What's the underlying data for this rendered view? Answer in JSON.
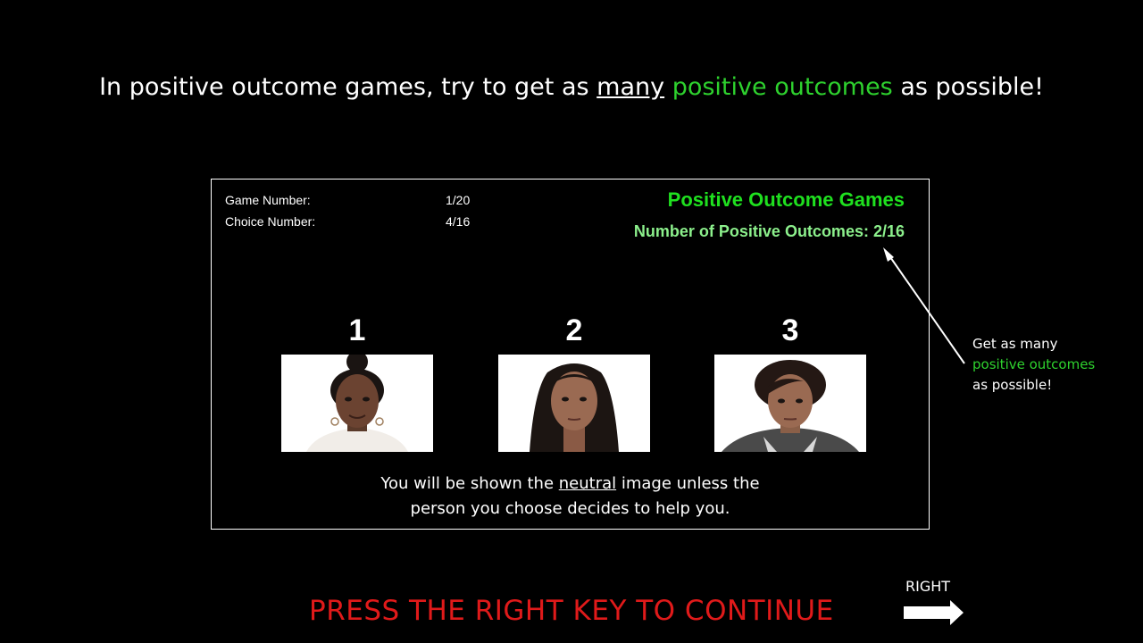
{
  "heading": {
    "part1": "In positive outcome games, try to get as ",
    "underlined": "many",
    "green": "positive outcomes",
    "part2": " as possible!"
  },
  "panel": {
    "game_number_label": "Game Number:",
    "game_number_value": "1/20",
    "choice_number_label": "Choice Number:",
    "choice_number_value": "4/16",
    "title": "Positive Outcome Games",
    "outcome_count": "Number of Positive Outcomes: 2/16",
    "choices": [
      {
        "number": "1",
        "face": "person-1"
      },
      {
        "number": "2",
        "face": "person-2"
      },
      {
        "number": "3",
        "face": "person-3"
      }
    ],
    "instruction": {
      "part1": "You will be shown the ",
      "underlined": "neutral",
      "part2": " image unless the",
      "line2": "person you choose decides to help you."
    }
  },
  "callout": {
    "line1": "Get as many",
    "line2": "positive outcomes",
    "line3": "as possible!"
  },
  "footer": {
    "press_text": "PRESS THE RIGHT KEY TO CONTINUE",
    "right_label": "RIGHT"
  },
  "colors": {
    "accent_green": "#2ed12e",
    "count_green": "#8cf08c",
    "press_red": "#e01a1a"
  }
}
